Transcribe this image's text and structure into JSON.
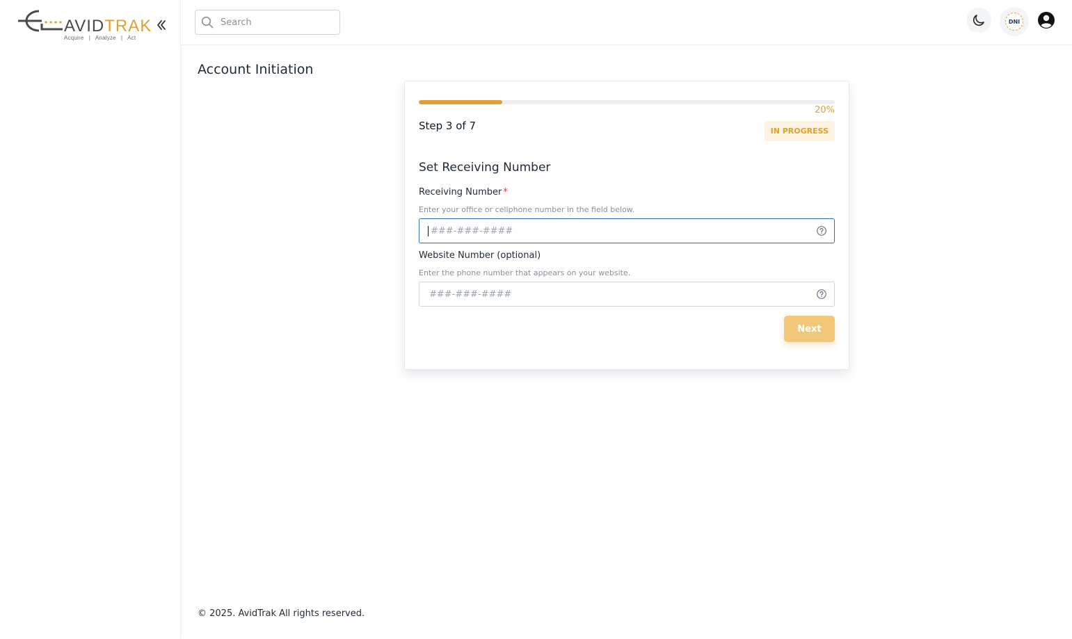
{
  "brand": {
    "wordmark_part1": "AVID",
    "wordmark_part2": "TRAK",
    "tagline": "Acquire   |   Analyze   |   Act",
    "accent_color": "#e0a030",
    "dark_color": "#4a4a4a"
  },
  "sidebar": {
    "collapse_icon": "double-chevron-left-icon"
  },
  "header": {
    "search": {
      "placeholder": "Search",
      "value": ""
    },
    "theme_icon": "moon-icon",
    "dni_badge": "DNI",
    "profile_icon": "user-circle-icon"
  },
  "page": {
    "title": "Account Initiation"
  },
  "wizard": {
    "progress_percent": 20,
    "progress_label": "20%",
    "step_text": "Step 3 of 7",
    "status": "IN PROGRESS",
    "section_title": "Set Receiving Number",
    "receiving": {
      "label": "Receiving Number",
      "required_mark": "*",
      "help": "Enter your office or cellphone number in the field below.",
      "placeholder": "###-###-####",
      "value": ""
    },
    "website": {
      "label": "Website Number (optional)",
      "help": "Enter the phone number that appears on your website.",
      "placeholder": "###-###-####",
      "value": ""
    },
    "next_label": "Next"
  },
  "footer": {
    "copyright": "© 2025. AvidTrak All rights reserved."
  }
}
